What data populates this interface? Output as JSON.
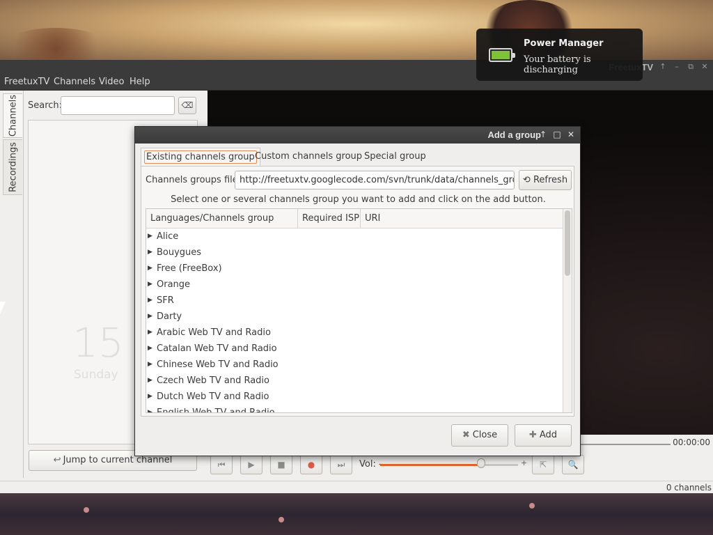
{
  "app": {
    "title": "FreetuxTV",
    "menu": [
      "FreetuxTV",
      "Channels",
      "Video",
      "Help"
    ],
    "window_controls": {
      "up": "↑",
      "min": "–",
      "restore": "⧉",
      "close": "✕"
    }
  },
  "notification": {
    "title": "Power Manager",
    "body": "Your battery is discharging"
  },
  "sidebar": {
    "tabs": [
      "Channels",
      "Recordings"
    ],
    "search_label": "Search:",
    "search_value": "",
    "clear_icon": "⌫",
    "jump_button": "Jump to current channel",
    "jump_icon": "↩"
  },
  "ghost_clock": {
    "time": "15",
    "day": "Sunday"
  },
  "player": {
    "time": "00:00:00",
    "volume_label": "Vol: -",
    "volume_plus": "+",
    "volume_level": 0.73,
    "buttons": {
      "prev": "⏮",
      "play": "▶",
      "stop": "■",
      "record": "●",
      "next": "⏭",
      "fullscreen": "⇱",
      "zoom": "🔍"
    }
  },
  "status": {
    "channels_count": "0 channels"
  },
  "dialog": {
    "title": "Add a group",
    "title_buttons": {
      "up": "↑",
      "max": "□",
      "close": "✕"
    },
    "tabs": [
      "Existing channels group",
      "Custom channels group",
      "Special group"
    ],
    "file_label": "Channels groups file:",
    "file_value": "http://freetuxtv.googlecode.com/svn/trunk/data/channels_groups",
    "refresh_label": "Refresh",
    "refresh_icon": "⟲",
    "instruction": "Select one or several channels group you want to add and click on the add button.",
    "columns": [
      "Languages/Channels group",
      "Required ISP",
      "URI"
    ],
    "rows": [
      "Alice",
      "Bouygues",
      "Free (FreeBox)",
      "Orange",
      "SFR",
      "Darty",
      "Arabic Web TV and Radio",
      "Catalan Web TV and Radio",
      "Chinese Web TV and Radio",
      "Czech Web TV and Radio",
      "Dutch Web TV and Radio",
      "English Web TV and Radio"
    ],
    "expander_icon": "▶",
    "close_label": "Close",
    "close_icon": "✖",
    "add_label": "Add",
    "add_icon": "✚"
  },
  "colors": {
    "accent": "#e0662e",
    "battery": "#7fc23a",
    "dark_chrome": "#3b3b3b"
  }
}
